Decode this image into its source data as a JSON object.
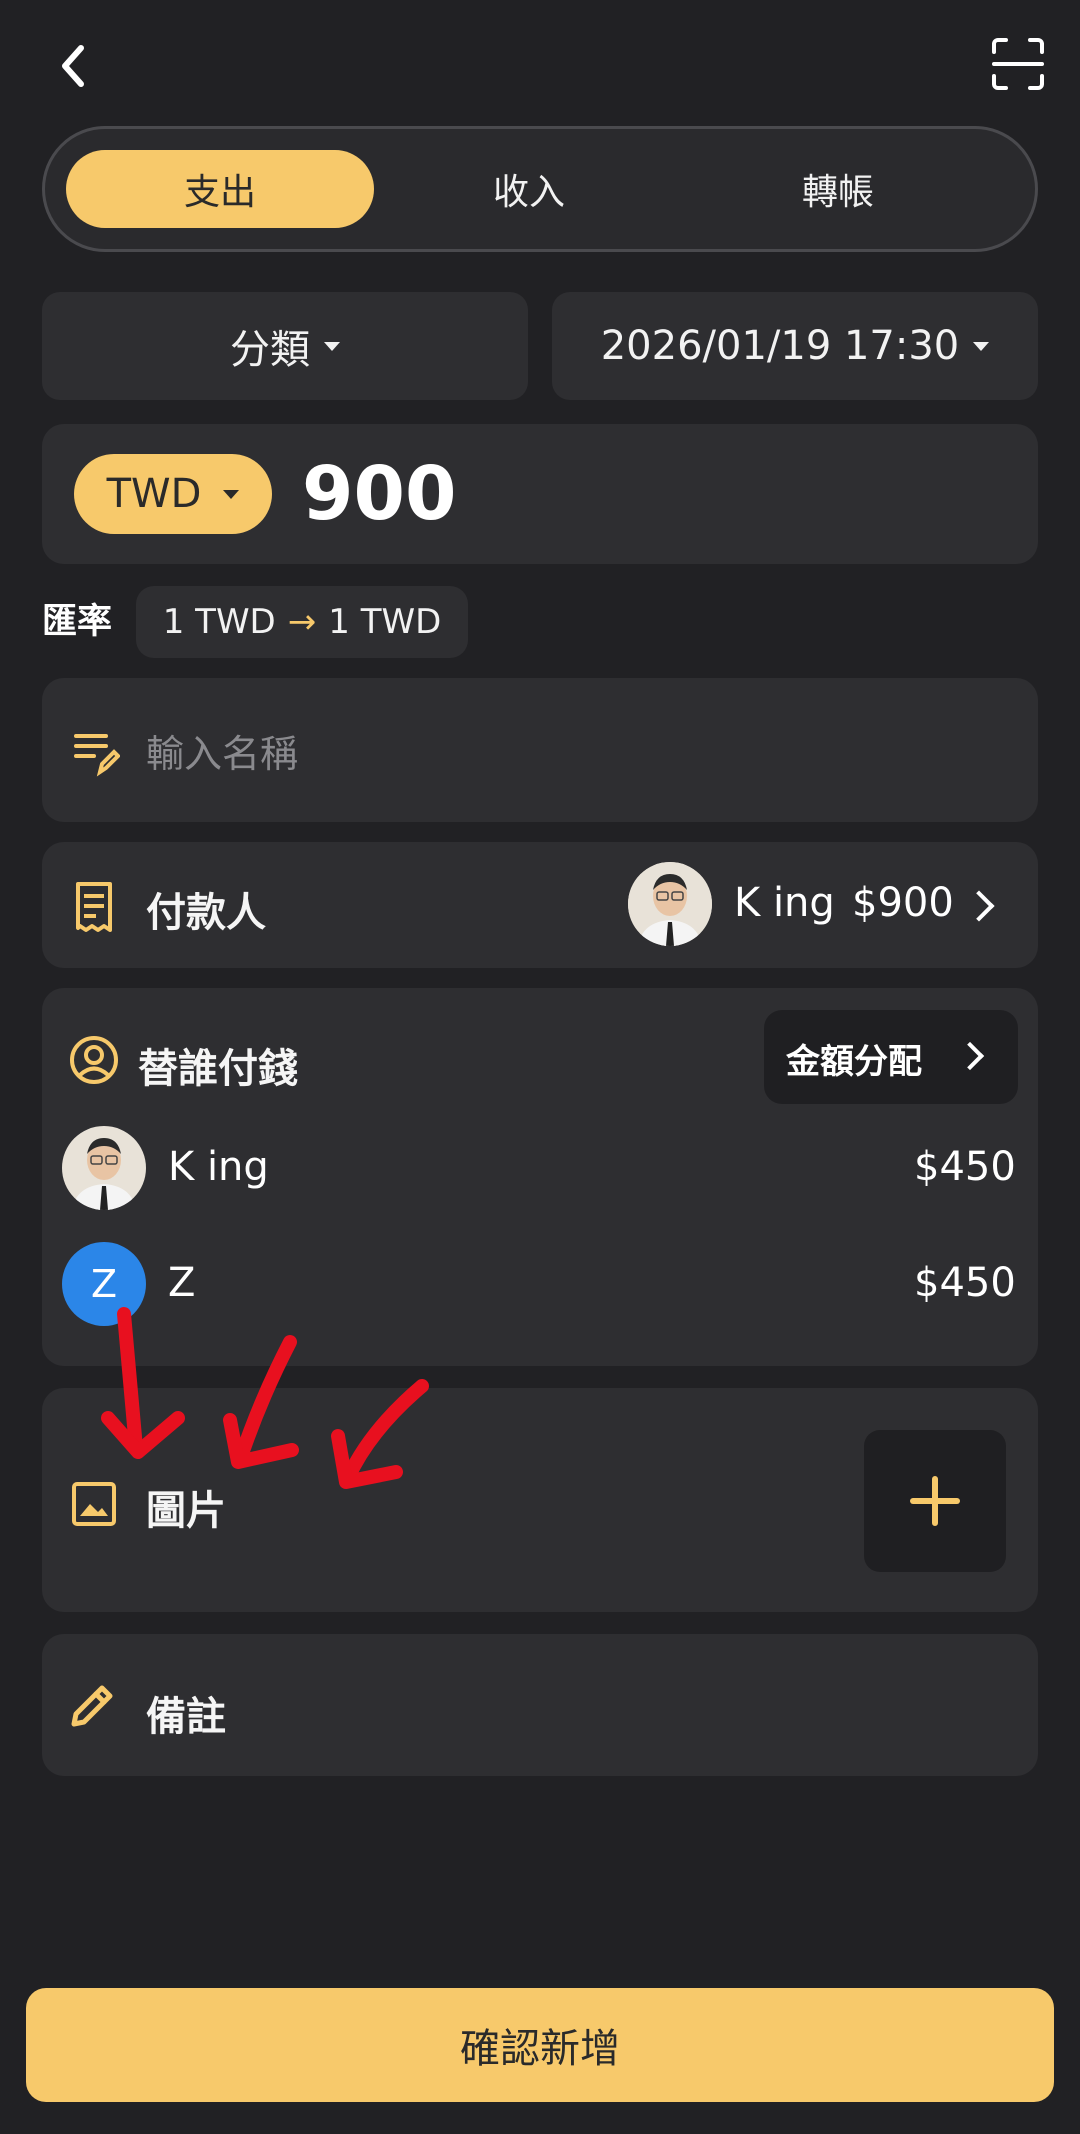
{
  "tabs": [
    {
      "label": "支出",
      "active": true
    },
    {
      "label": "收入",
      "active": false
    },
    {
      "label": "轉帳",
      "active": false
    }
  ],
  "category": {
    "label": "分類"
  },
  "datetime": {
    "value": "2026/01/19 17:30"
  },
  "amount": {
    "currency": "TWD",
    "value": "900"
  },
  "exchange_rate": {
    "label": "匯率",
    "from": "1 TWD",
    "to": "1 TWD"
  },
  "name_field": {
    "placeholder": "輸入名稱",
    "value": ""
  },
  "payer": {
    "label": "付款人",
    "name": "K ing",
    "amount": "$900"
  },
  "split": {
    "label": "替誰付錢",
    "allocate_label": "金額分配",
    "people": [
      {
        "name": "K ing",
        "amount": "$450",
        "avatar": "photo"
      },
      {
        "name": "Z",
        "amount": "$450",
        "avatar": "letter",
        "initial": "Z",
        "avatar_color": "#2b86e8"
      }
    ]
  },
  "image_section": {
    "label": "圖片"
  },
  "note_section": {
    "label": "備註"
  },
  "confirm_button": {
    "label": "確認新增"
  },
  "colors": {
    "accent": "#f7c96b",
    "background": "#212124",
    "card": "#2e2e31",
    "annotation": "#e8101f"
  },
  "icons": [
    "back-chevron-icon",
    "scan-icon",
    "list-edit-icon",
    "receipt-icon",
    "person-circle-icon",
    "image-icon",
    "plus-icon",
    "pencil-icon",
    "chevron-right-icon",
    "arrow-right-icon"
  ]
}
